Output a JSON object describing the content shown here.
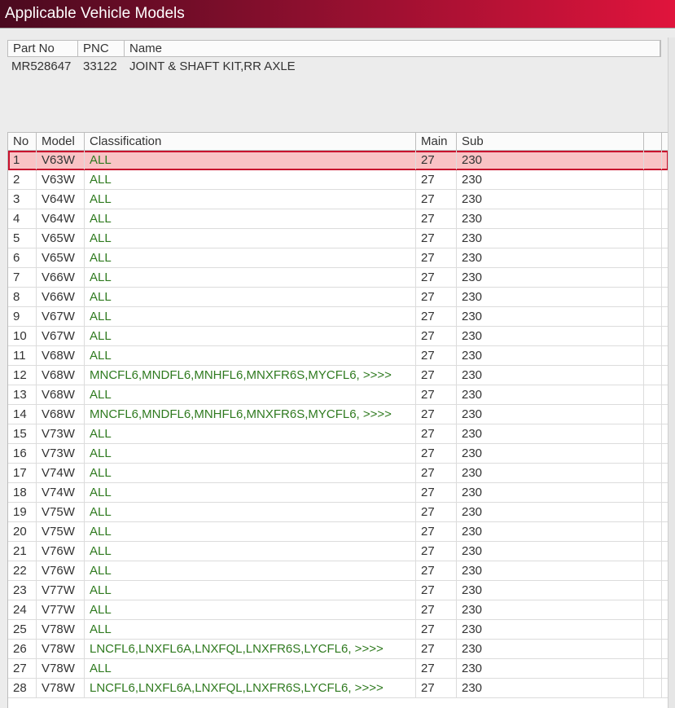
{
  "window": {
    "title": "Applicable Vehicle Models"
  },
  "part_table": {
    "headers": [
      "Part No",
      "PNC",
      "Name"
    ],
    "row": {
      "part_no": "MR528647",
      "pnc": "33122",
      "name": "JOINT & SHAFT KIT,RR AXLE"
    }
  },
  "model_table": {
    "headers": [
      "No",
      "Model",
      "Classification",
      "Main",
      "Sub"
    ],
    "selected_row": 1,
    "rows": [
      {
        "no": "1",
        "model": "V63W",
        "classification": "ALL",
        "main": "27",
        "sub": "230"
      },
      {
        "no": "2",
        "model": "V63W",
        "classification": "ALL",
        "main": "27",
        "sub": "230"
      },
      {
        "no": "3",
        "model": "V64W",
        "classification": "ALL",
        "main": "27",
        "sub": "230"
      },
      {
        "no": "4",
        "model": "V64W",
        "classification": "ALL",
        "main": "27",
        "sub": "230"
      },
      {
        "no": "5",
        "model": "V65W",
        "classification": "ALL",
        "main": "27",
        "sub": "230"
      },
      {
        "no": "6",
        "model": "V65W",
        "classification": "ALL",
        "main": "27",
        "sub": "230"
      },
      {
        "no": "7",
        "model": "V66W",
        "classification": "ALL",
        "main": "27",
        "sub": "230"
      },
      {
        "no": "8",
        "model": "V66W",
        "classification": "ALL",
        "main": "27",
        "sub": "230"
      },
      {
        "no": "9",
        "model": "V67W",
        "classification": "ALL",
        "main": "27",
        "sub": "230"
      },
      {
        "no": "10",
        "model": "V67W",
        "classification": "ALL",
        "main": "27",
        "sub": "230"
      },
      {
        "no": "11",
        "model": "V68W",
        "classification": "ALL",
        "main": "27",
        "sub": "230"
      },
      {
        "no": "12",
        "model": "V68W",
        "classification": "MNCFL6,MNDFL6,MNHFL6,MNXFR6S,MYCFL6,  >>>>",
        "main": "27",
        "sub": "230"
      },
      {
        "no": "13",
        "model": "V68W",
        "classification": "ALL",
        "main": "27",
        "sub": "230"
      },
      {
        "no": "14",
        "model": "V68W",
        "classification": "MNCFL6,MNDFL6,MNHFL6,MNXFR6S,MYCFL6,  >>>>",
        "main": "27",
        "sub": "230"
      },
      {
        "no": "15",
        "model": "V73W",
        "classification": "ALL",
        "main": "27",
        "sub": "230"
      },
      {
        "no": "16",
        "model": "V73W",
        "classification": "ALL",
        "main": "27",
        "sub": "230"
      },
      {
        "no": "17",
        "model": "V74W",
        "classification": "ALL",
        "main": "27",
        "sub": "230"
      },
      {
        "no": "18",
        "model": "V74W",
        "classification": "ALL",
        "main": "27",
        "sub": "230"
      },
      {
        "no": "19",
        "model": "V75W",
        "classification": "ALL",
        "main": "27",
        "sub": "230"
      },
      {
        "no": "20",
        "model": "V75W",
        "classification": "ALL",
        "main": "27",
        "sub": "230"
      },
      {
        "no": "21",
        "model": "V76W",
        "classification": "ALL",
        "main": "27",
        "sub": "230"
      },
      {
        "no": "22",
        "model": "V76W",
        "classification": "ALL",
        "main": "27",
        "sub": "230"
      },
      {
        "no": "23",
        "model": "V77W",
        "classification": "ALL",
        "main": "27",
        "sub": "230"
      },
      {
        "no": "24",
        "model": "V77W",
        "classification": "ALL",
        "main": "27",
        "sub": "230"
      },
      {
        "no": "25",
        "model": "V78W",
        "classification": "ALL",
        "main": "27",
        "sub": "230"
      },
      {
        "no": "26",
        "model": "V78W",
        "classification": "LNCFL6,LNXFL6A,LNXFQL,LNXFR6S,LYCFL6,  >>>>",
        "main": "27",
        "sub": "230"
      },
      {
        "no": "27",
        "model": "V78W",
        "classification": "ALL",
        "main": "27",
        "sub": "230"
      },
      {
        "no": "28",
        "model": "V78W",
        "classification": "LNCFL6,LNXFL6A,LNXFQL,LNXFR6S,LYCFL6,  >>>>",
        "main": "27",
        "sub": "230"
      }
    ]
  },
  "colors": {
    "title_gradient_start": "#4a0a1f",
    "title_gradient_end": "#e0143c",
    "selected_row_fill": "#f9c3c5",
    "selected_row_border": "#c8122e",
    "classification_text": "#2f7a1f"
  }
}
